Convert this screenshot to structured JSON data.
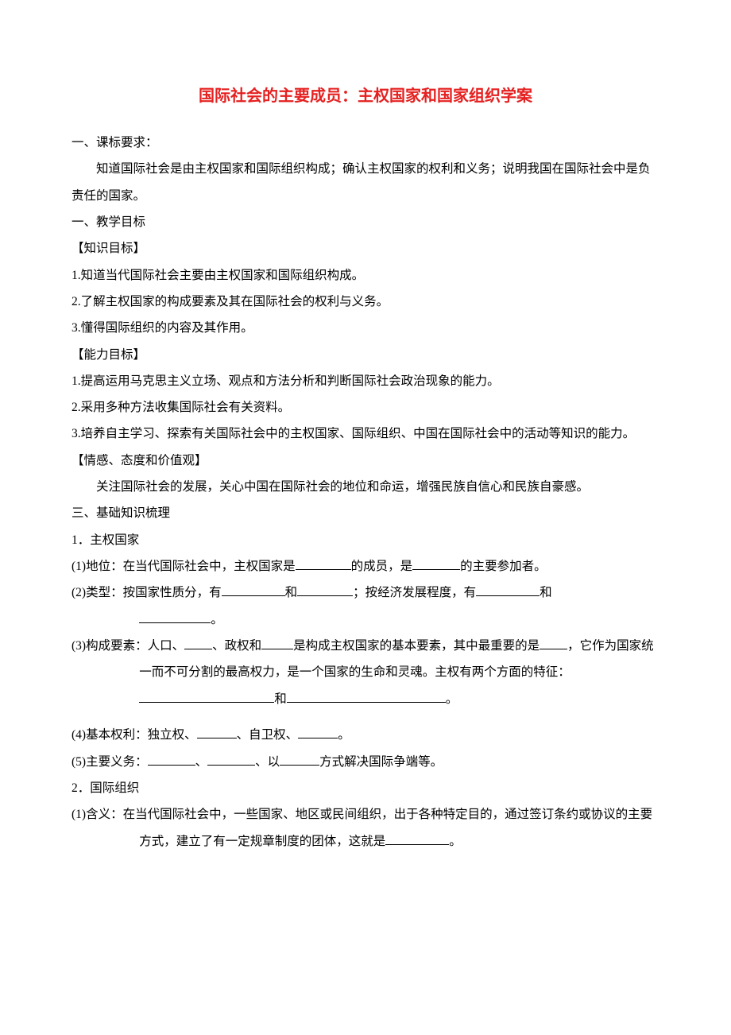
{
  "title": "国际社会的主要成员：主权国家和国家组织学案",
  "sec1_heading": "一、课标要求：",
  "sec1_body": "知道国际社会是由主权国家和国际组织构成；确认主权国家的权利和义务；说明我国在国际社会中是负责任的国家。",
  "sec2_heading": "一、教学目标",
  "kg_heading": "【知识目标】",
  "kg1": "1.知道当代国际社会主要由主权国家和国际组织构成。",
  "kg2": "2.了解主权国家的构成要素及其在国际社会的权利与义务。",
  "kg3": "3.懂得国际组织的内容及其作用。",
  "ab_heading": "【能力目标】",
  "ab1": "1.提高运用马克思主义立场、观点和方法分析和判断国际社会政治现象的能力。",
  "ab2": "2.采用多种方法收集国际社会有关资料。",
  "ab3": "3.培养自主学习、探索有关国际社会中的主权国家、国际组织、中国在国际社会中的活动等知识的能力。",
  "em_heading": "【情感、态度和价值观】",
  "em_body": "关注国际社会的发展，关心中国在国际社会的地位和命运，增强民族自信心和民族自豪感。",
  "sec3_heading": "三、基础知识梳理",
  "s1_heading": "1．主权国家",
  "s1_1a": "(1)地位：在当代国际社会中，主权国家是",
  "s1_1b": "的成员，是",
  "s1_1c": "的主要参加者。",
  "s1_2a": "(2)类型：按国家性质分，有",
  "s1_2b": "和",
  "s1_2c": "；按经济发展程度，有",
  "s1_2d": "和",
  "s1_2e": "。",
  "s1_3a": "(3)构成要素：人口、",
  "s1_3b": "、政权和",
  "s1_3c": "是构成主权国家的基本要素，其中最重要的是",
  "s1_3d": "，它作为国家统一而不可分割的最高权力，是一个国家的生命和灵魂。主权有两个方面的特征：",
  "s1_3e": "和",
  "s1_3f": "。",
  "s1_4a": "(4)基本权利：独立权、",
  "s1_4b": "、自卫权、",
  "s1_4c": "。",
  "s1_5a": "(5)主要义务：",
  "s1_5b": "、",
  "s1_5c": "、以",
  "s1_5d": "方式解决国际争端等。",
  "s2_heading": "2．国际组织",
  "s2_1a": "(1)含义：在当代国际社会中，一些国家、地区或民间组织，出于各种特定目的，通过签订条约或协议的主要方式，建立了有一定规章制度的团体，这就是",
  "s2_1b": "。"
}
